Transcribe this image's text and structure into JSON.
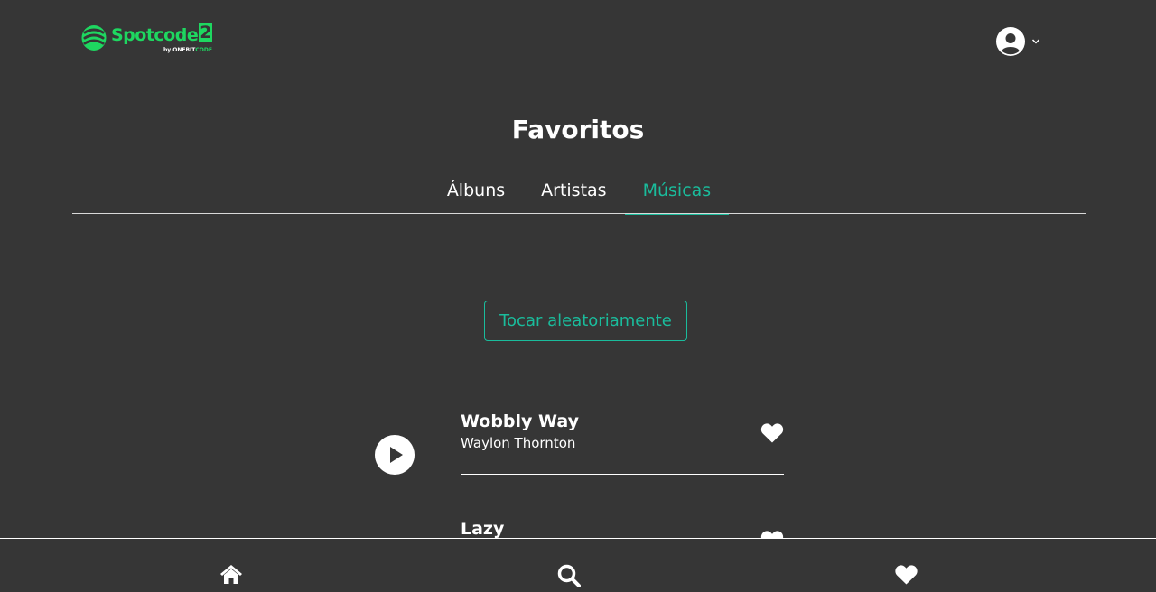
{
  "header": {
    "logo_text": "Spotcode",
    "logo_number": "2",
    "logo_sub_prefix": "by",
    "logo_sub_onebit": "ONEBIT",
    "logo_sub_code": "CODE"
  },
  "page": {
    "title": "Favoritos"
  },
  "tabs": [
    {
      "label": "Álbuns",
      "active": false
    },
    {
      "label": "Artistas",
      "active": false
    },
    {
      "label": "Músicas",
      "active": true
    }
  ],
  "shuffle_label": "Tocar aleatoriamente",
  "songs": [
    {
      "title": "Wobbly Way",
      "artist": "Waylon Thornton",
      "favorited": true
    },
    {
      "title": "Lazy",
      "artist": "",
      "favorited": true
    }
  ],
  "bottom_nav": [
    {
      "icon": "home-icon"
    },
    {
      "icon": "search-icon"
    },
    {
      "icon": "heart-icon"
    }
  ],
  "colors": {
    "background": "#363636",
    "accent": "#1abc9c",
    "brand": "#1ed760",
    "text": "#ffffff"
  }
}
